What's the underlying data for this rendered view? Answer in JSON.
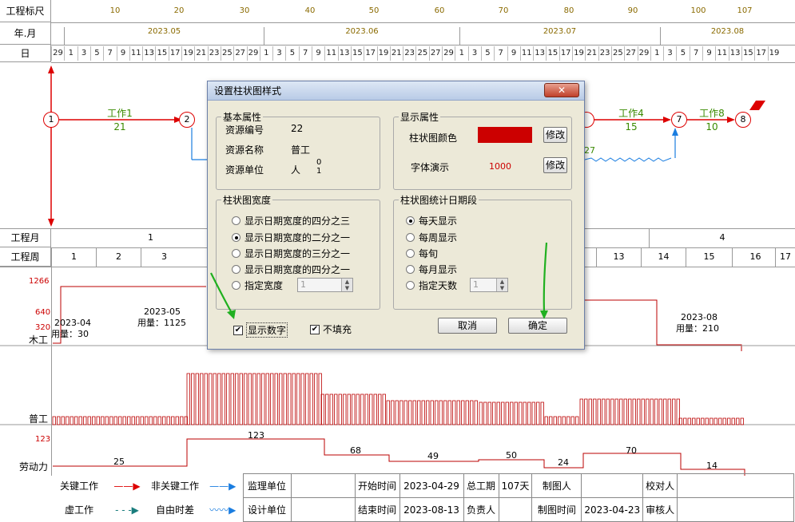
{
  "header": {
    "ruler_label": "工程标尺",
    "ruler_ticks": [
      "10",
      "20",
      "30",
      "40",
      "50",
      "60",
      "70",
      "80",
      "90",
      "100",
      "107"
    ],
    "ym_label": "年.月",
    "months": [
      "2023.05",
      "2023.06",
      "2023.07",
      "2023.08"
    ],
    "day_label": "日",
    "days": [
      "29",
      "1",
      "3",
      "5",
      "7",
      "9",
      "11",
      "13",
      "15",
      "17",
      "19",
      "21",
      "23",
      "25",
      "27",
      "29",
      "1",
      "3",
      "5",
      "7",
      "9",
      "11",
      "13",
      "15",
      "17",
      "19",
      "21",
      "23",
      "25",
      "27",
      "29",
      "1",
      "3",
      "5",
      "7",
      "9",
      "11",
      "13",
      "15",
      "17",
      "19",
      "21",
      "23",
      "25",
      "27",
      "29",
      "1",
      "3",
      "5",
      "7",
      "9",
      "11",
      "13",
      "15",
      "17",
      "19"
    ]
  },
  "network": {
    "nodes": [
      "1",
      "2",
      "7",
      "8"
    ],
    "tasks": [
      {
        "name": "工作1",
        "dur": "21"
      },
      {
        "name": "工作4",
        "dur": "15"
      },
      {
        "name": "工作8",
        "dur": "10"
      }
    ],
    "partial_dur": "27"
  },
  "bands": {
    "month_label": "工程月",
    "month_vals": [
      "1",
      "4"
    ],
    "week_label": "工程周",
    "week_vals": [
      "1",
      "2",
      "3",
      "13",
      "14",
      "15",
      "16",
      "17"
    ]
  },
  "resources": {
    "carpenter": {
      "label": "木工",
      "y1": "1266",
      "y2": "640",
      "y3": "320",
      "notes": [
        {
          "date": "2023-04",
          "use": "用量：30"
        },
        {
          "date": "2023-05",
          "use": "用量：1125"
        },
        {
          "date": "2023-08",
          "use": "用量：210"
        }
      ]
    },
    "laborer": {
      "label": "普工"
    },
    "labor": {
      "label": "劳动力",
      "max": "123",
      "values": [
        "25",
        "123",
        "68",
        "49",
        "50",
        "24",
        "70",
        "14"
      ]
    }
  },
  "legend": {
    "critical": "关键工作",
    "noncritical": "非关键工作",
    "dummy": "虚工作",
    "float": "自由时差",
    "supervisor": "监理单位",
    "designer": "设计单位",
    "start_label": "开始时间",
    "start": "2023-04-29",
    "end_label": "结束时间",
    "end": "2023-08-13",
    "total_label": "总工期",
    "total": "107天",
    "owner_label": "负责人",
    "drawer_label": "制图人",
    "drawtime_label": "制图时间",
    "drawtime": "2023-04-23",
    "checker_label": "校对人",
    "reviewer_label": "审核人"
  },
  "dialog": {
    "title": "设置柱状图样式",
    "close": "✕",
    "basic": {
      "legend": "基本属性",
      "id_label": "资源编号",
      "id": "22",
      "name_label": "资源名称",
      "name": "普工",
      "unit_label": "资源单位",
      "unit": "人",
      "n0": "0",
      "n1": "1"
    },
    "display": {
      "legend": "显示属性",
      "color_label": "柱状图颜色",
      "color": "#cc0000",
      "font_label": "字体演示",
      "font_demo": "1000",
      "modify": "修改"
    },
    "width": {
      "legend": "柱状图宽度",
      "options": [
        "显示日期宽度的四分之三",
        "显示日期宽度的二分之一",
        "显示日期宽度的三分之一",
        "显示日期宽度的四分之一",
        "指定宽度"
      ],
      "selected": 1,
      "spin": "1"
    },
    "period": {
      "legend": "柱状图统计日期段",
      "options": [
        "每天显示",
        "每周显示",
        "每旬",
        "每月显示",
        "指定天数"
      ],
      "selected": 0,
      "spin": "1"
    },
    "show_number": "显示数字",
    "no_fill": "不填充",
    "cancel": "取消",
    "ok": "确定"
  },
  "colors": {
    "critical": "#d00000",
    "noncritical": "#1a7de0",
    "tick": "#8a6a00",
    "task": "#3a8a00",
    "bar": "#b00000",
    "arrow": "#20b020"
  }
}
